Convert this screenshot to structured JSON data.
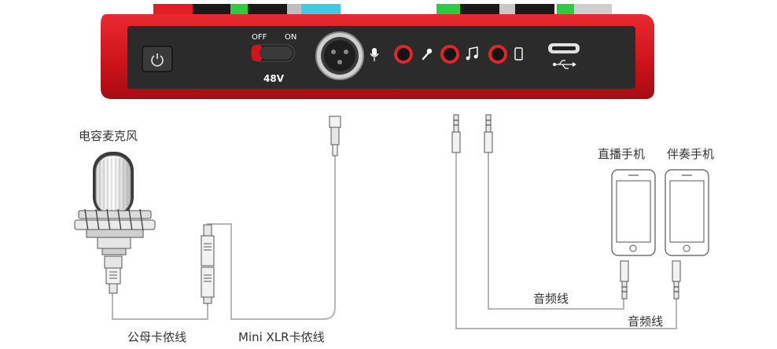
{
  "device": {
    "switch": {
      "off_label": "OFF",
      "on_label": "ON",
      "phantom_label": "48V"
    },
    "ports": [
      {
        "id": "mic-in",
        "icon": "microphone-icon"
      },
      {
        "id": "headset",
        "icon": "handheld-mic-icon"
      },
      {
        "id": "music-in",
        "icon": "music-note-icon"
      },
      {
        "id": "phone-out",
        "icon": "smartphone-icon"
      }
    ],
    "usb_icon": "usb-icon",
    "power_icon": "power-icon",
    "colors": {
      "body": "#d8121b",
      "panel": "#2b2b2b",
      "port_ring": "#e3242b"
    }
  },
  "labels": {
    "condenser_mic": "电容麦克风",
    "male_female_cable": "公母卡侬线",
    "mini_xlr_cable": "Mini XLR卡侬线",
    "live_phone": "直播手机",
    "accompaniment_phone": "伴奏手机",
    "audio_cable_1": "音频线",
    "audio_cable_2": "音频线"
  }
}
